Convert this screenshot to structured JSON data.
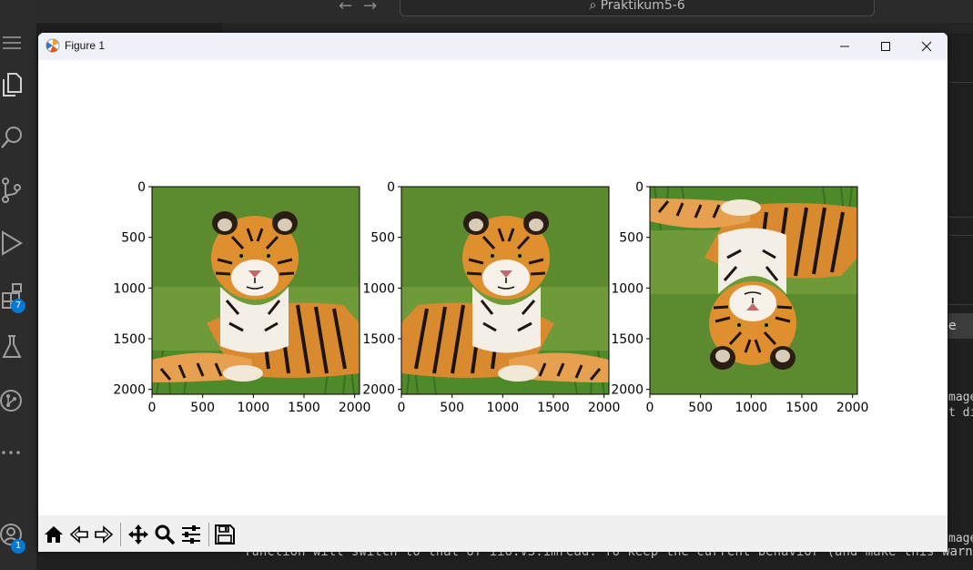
{
  "vscode": {
    "search_text": "Praktikum5-6",
    "right_button_text": "e",
    "terminal_right_lines": [
      "mage",
      "t di"
    ],
    "terminal_right_lines_lower": [
      "mage"
    ],
    "terminal_bottom_line": "function will switch to that of iio.v3.imread. To keep the current behavior (and make this warning di",
    "extensions_badge": "7",
    "accounts_badge": "1"
  },
  "figure": {
    "title": "Figure 1",
    "subplots": [
      {
        "xticks": [
          "0",
          "500",
          "1000",
          "1500",
          "2000"
        ],
        "yticks": [
          "0",
          "500",
          "1000",
          "1500",
          "2000"
        ],
        "image": "tiger-original"
      },
      {
        "xticks": [
          "0",
          "500",
          "1000",
          "1500",
          "2000"
        ],
        "yticks": [
          "0",
          "500",
          "1000",
          "1500",
          "2000"
        ],
        "image": "tiger-flipped-horizontal"
      },
      {
        "xticks": [
          "0",
          "500",
          "1000",
          "1500",
          "2000"
        ],
        "yticks": [
          "0",
          "500",
          "1000",
          "1500",
          "2000"
        ],
        "image": "tiger-flipped-vertical"
      }
    ],
    "toolbar": {
      "icons": [
        "home-icon",
        "back-icon",
        "forward-icon",
        "pan-icon",
        "zoom-icon",
        "configure-subplots-icon",
        "save-icon"
      ]
    }
  }
}
